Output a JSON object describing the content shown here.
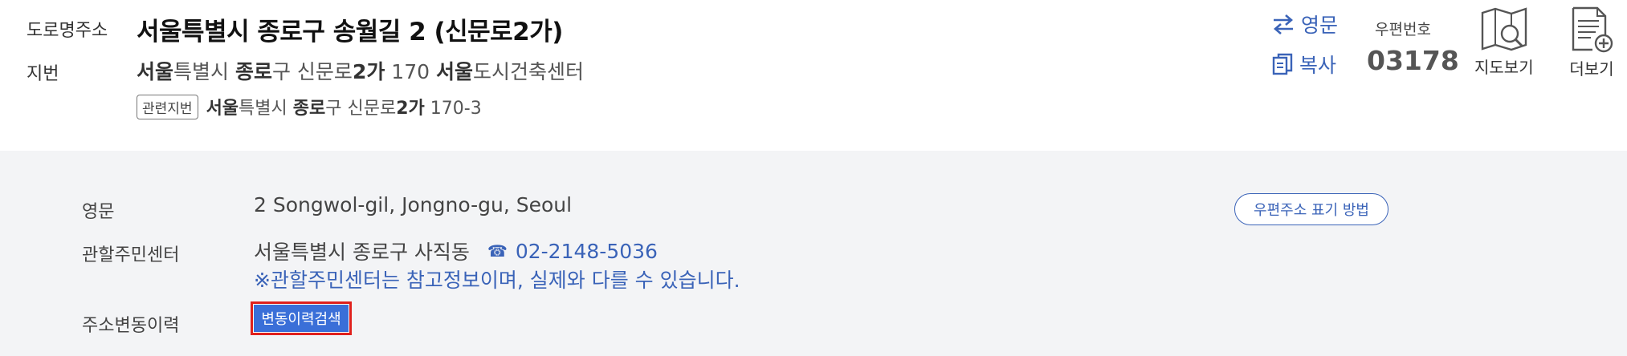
{
  "labels": {
    "road_address": "도로명주소",
    "jibun": "지번"
  },
  "road_address": "서울특별시 종로구 송월길 2 (신문로2가)",
  "jibun_address": {
    "parts": [
      {
        "text": "서울",
        "bold": true
      },
      {
        "text": "특별시 ",
        "bold": false
      },
      {
        "text": "종로",
        "bold": true
      },
      {
        "text": "구 신문로",
        "bold": false
      },
      {
        "text": "2가",
        "bold": true
      },
      {
        "text": " 170 ",
        "bold": false
      },
      {
        "text": "서울",
        "bold": true
      },
      {
        "text": "도시건축센터",
        "bold": false
      }
    ]
  },
  "related_jibun": {
    "tag": "관련지번",
    "parts": [
      {
        "text": "서울",
        "bold": true
      },
      {
        "text": "특별시 ",
        "bold": false
      },
      {
        "text": "종로",
        "bold": true
      },
      {
        "text": "구 신문로",
        "bold": false
      },
      {
        "text": "2가",
        "bold": true
      },
      {
        "text": " 170-3",
        "bold": false
      }
    ]
  },
  "actions": {
    "english": "영문",
    "copy": "복사"
  },
  "zipcode": {
    "label": "우편번호",
    "value": "03178"
  },
  "tools": {
    "map": "지도보기",
    "more": "더보기"
  },
  "details": {
    "english_label": "영문",
    "english_value": "2 Songwol-gil, Jongno-gu, Seoul",
    "center_label": "관할주민센터",
    "center_value": "서울특별시 종로구 사직동",
    "phone": "02-2148-5036",
    "note": "※관할주민센터는 참고정보이며, 실제와 다를 수 있습니다.",
    "history_label": "주소변동이력",
    "history_button": "변동이력검색",
    "postal_guide_button": "우편주소 표기 방법"
  },
  "colors": {
    "accent": "#3a63b8",
    "button": "#3a6fd8",
    "highlight": "#e0201c",
    "panel_bg": "#f3f4f6"
  }
}
